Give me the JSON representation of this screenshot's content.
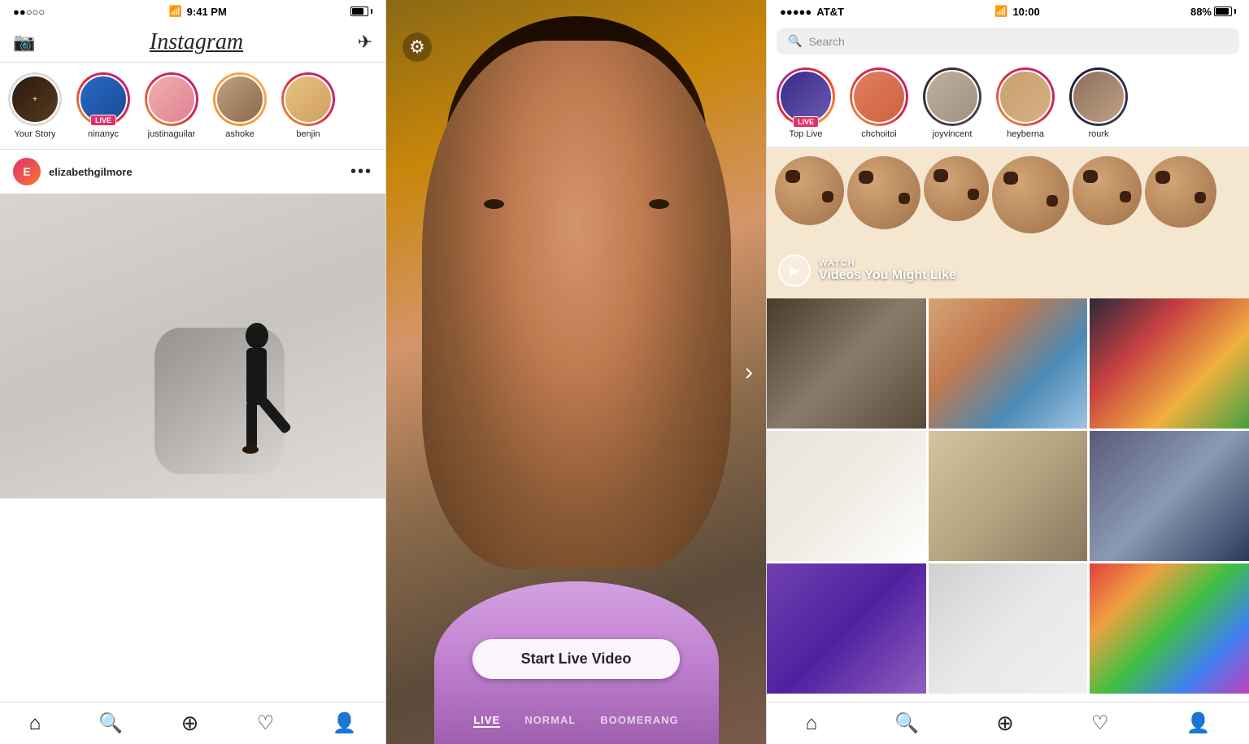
{
  "panel1": {
    "status": {
      "signal": "●●○○○",
      "wifi": "wifi",
      "time": "9:41 PM",
      "battery": "■■■■"
    },
    "header": {
      "camera_label": "📷",
      "logo": "Instagram",
      "dm_label": "✈"
    },
    "stories": [
      {
        "id": "your-story",
        "label": "Your Story",
        "type": "yours"
      },
      {
        "id": "ninanyc",
        "label": "ninanyc",
        "type": "live"
      },
      {
        "id": "justinaguilar",
        "label": "justinaguilar",
        "type": "story"
      },
      {
        "id": "ashoke",
        "label": "ashoke",
        "type": "story"
      },
      {
        "id": "benjin",
        "label": "benjin",
        "type": "story"
      }
    ],
    "live_badge": "LIVE",
    "post": {
      "username": "elizabethgilmore",
      "more": "•••"
    },
    "nav": {
      "home": "⌂",
      "search": "🔍",
      "add": "⊕",
      "heart": "♡",
      "profile": "👤"
    }
  },
  "panel2": {
    "settings_label": "⚙",
    "next_label": "›",
    "start_live_label": "Start Live Video",
    "modes": [
      "LIVE",
      "NORMAL",
      "BOOMERANG"
    ]
  },
  "panel3": {
    "status": {
      "dots": "●●●●●",
      "carrier": "AT&T",
      "wifi": "wifi",
      "time": "10:00",
      "battery_pct": "88%"
    },
    "search": {
      "placeholder": "Search"
    },
    "stories": [
      {
        "id": "top-live",
        "label": "Top Live",
        "badge": "LIVE",
        "type": "top-live"
      },
      {
        "id": "chchoitoi",
        "label": "chchoitoi",
        "type": "story"
      },
      {
        "id": "joyvincent",
        "label": "joyvincent",
        "type": "story"
      },
      {
        "id": "heyberna",
        "label": "heyberna",
        "type": "story"
      },
      {
        "id": "rourk",
        "label": "rourk",
        "type": "story"
      }
    ],
    "watch": {
      "label": "WATCH",
      "title": "Videos You Might Like",
      "play_icon": "▶"
    },
    "nav": {
      "home": "⌂",
      "search": "🔍",
      "add": "⊕",
      "heart": "♡",
      "profile": "👤"
    }
  }
}
